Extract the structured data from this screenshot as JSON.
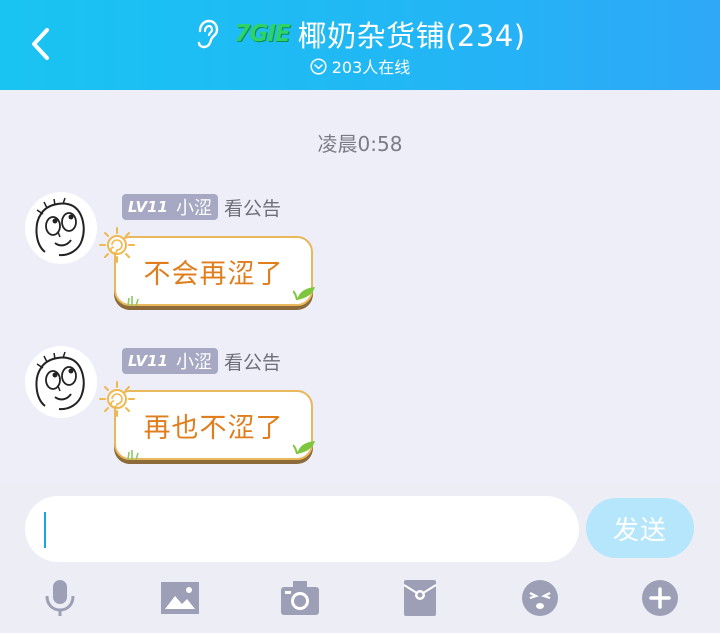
{
  "header": {
    "back_icon": "back-chevron-icon",
    "ear_icon": "ear-icon",
    "level_badge": "7GIE",
    "title": "椰奶杂货铺(234)",
    "online_icon": "chevron-down-circle-icon",
    "online_text": "203人在线",
    "colors": {
      "header_start": "#19c4f2",
      "header_end": "#2ea8f7"
    }
  },
  "chat": {
    "timestamp": "凌晨0:58",
    "messages": [
      {
        "level": "LV11",
        "nickname": "小涩",
        "title": "看公告",
        "text": "不会再涩了",
        "avatar_icon": "rage-face-avatar"
      },
      {
        "level": "LV11",
        "nickname": "小涩",
        "title": "看公告",
        "text": "再也不涩了",
        "avatar_icon": "rage-face-avatar"
      }
    ],
    "colors": {
      "bubble_text": "#e07d1d",
      "bubble_border": "#e8b85a",
      "level_badge_bg": "#a7a8c3"
    }
  },
  "composer": {
    "input_value": "",
    "send_label": "发送",
    "tools": [
      "microphone-icon",
      "image-icon",
      "camera-icon",
      "red-packet-icon",
      "emoji-icon",
      "plus-icon"
    ],
    "colors": {
      "send_bg": "#b6e6fb",
      "tool_color": "#9d9fb6"
    }
  }
}
